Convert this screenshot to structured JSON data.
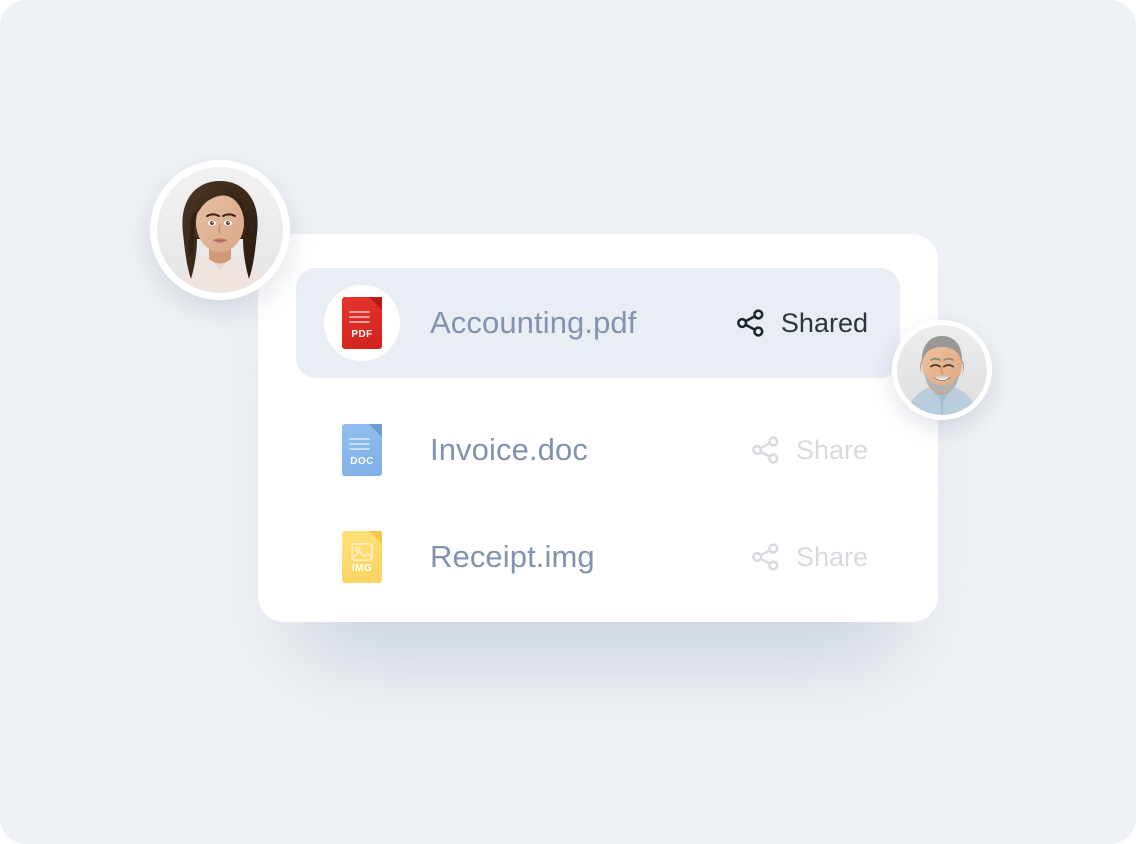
{
  "page": {
    "background_color": "#eef1f5",
    "card_background": "#ffffff",
    "selected_row_background": "#e9edf4"
  },
  "card": {
    "name": "file-list-card",
    "rows": [
      {
        "file_name": "Accounting.pdf",
        "file_type": "pdf",
        "type_tag": "PDF",
        "icon_color": "#dc2a23",
        "selected": true,
        "share": {
          "label": "Shared",
          "state": "shared",
          "icon": "share-icon",
          "label_color": "#2c3442"
        }
      },
      {
        "file_name": "Invoice.doc",
        "file_type": "doc",
        "type_tag": "DOC",
        "icon_color": "#8ab6ec",
        "selected": false,
        "share": {
          "label": "Share",
          "state": "not-shared",
          "icon": "share-icon",
          "label_color": "#d7dade"
        }
      },
      {
        "file_name": "Receipt.img",
        "file_type": "img",
        "type_tag": "IMG",
        "icon_color": "#fdd868",
        "selected": false,
        "share": {
          "label": "Share",
          "state": "not-shared",
          "icon": "share-icon",
          "label_color": "#d7dade"
        }
      }
    ]
  },
  "avatars": [
    {
      "name": "avatar-woman",
      "description": "Portrait of a smiling woman with long wavy dark brown hair wearing a light blush high-neck top",
      "position": "top-left"
    },
    {
      "name": "avatar-man",
      "description": "Portrait of a smiling middle-aged man with short grey hair and a grey beard wearing a light blue shirt",
      "position": "right"
    }
  ],
  "colors": {
    "file_name_text": "#8193ae",
    "shared_text": "#2c3442",
    "share_muted_text": "#d7dade"
  }
}
